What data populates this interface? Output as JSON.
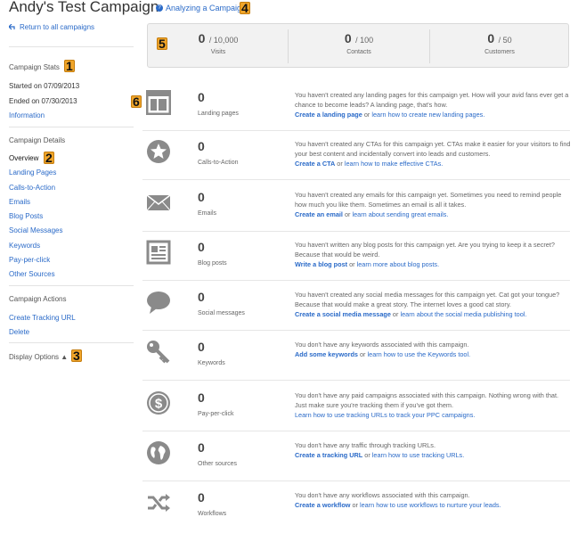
{
  "header": {
    "title": "Andy's Test Campaign",
    "help_link": "Analyzing a Campaign"
  },
  "badges": [
    "1",
    "2",
    "3",
    "4",
    "5",
    "6"
  ],
  "sidebar": {
    "back_link": "Return to all campaigns",
    "stats_heading": "Campaign Stats",
    "started": "Started on 07/09/2013",
    "ended": "Ended on 07/30/2013",
    "information": "Information",
    "details_heading": "Campaign Details",
    "details_items": [
      "Overview",
      "Landing Pages",
      "Calls-to-Action",
      "Emails",
      "Blog Posts",
      "Social Messages",
      "Keywords",
      "Pay-per-click",
      "Other Sources"
    ],
    "actions_heading": "Campaign Actions",
    "actions_items": [
      "Create Tracking URL",
      "Delete"
    ],
    "display_options": "Display Options ▲"
  },
  "stats": [
    {
      "value": "0",
      "limit": "/ 10,000",
      "label": "Visits"
    },
    {
      "value": "0",
      "limit": "/ 100",
      "label": "Contacts"
    },
    {
      "value": "0",
      "limit": "/ 50",
      "label": "Customers"
    }
  ],
  "rows": [
    {
      "count": "0",
      "label": "Landing pages",
      "icon": "landing-page-icon",
      "text": "You haven't created any landing pages for this campaign yet. How will your avid fans ever get a chance to become leads? A landing page, that's how.",
      "cta": "Create a landing page",
      "or": " or ",
      "alt": "learn how to create new landing pages."
    },
    {
      "count": "0",
      "label": "Calls-to-Action",
      "icon": "star-icon",
      "text": "You haven't created any CTAs for this campaign yet. CTAs make it easier for your visitors to find your best content and incidentally convert into leads and customers.",
      "cta": "Create a CTA",
      "or": " or ",
      "alt": "learn how to make effective CTAs."
    },
    {
      "count": "0",
      "label": "Emails",
      "icon": "envelope-icon",
      "text": "You haven't created any emails for this campaign yet. Sometimes you need to remind people how much you like them. Sometimes an email is all it takes.",
      "cta": "Create an email",
      "or": " or ",
      "alt": "learn about sending great emails."
    },
    {
      "count": "0",
      "label": "Blog posts",
      "icon": "newspaper-icon",
      "text": "You haven't written any blog posts for this campaign yet. Are you trying to keep it a secret? Because that would be weird.",
      "cta": "Write a blog post",
      "or": " or ",
      "alt": "learn more about blog posts."
    },
    {
      "count": "0",
      "label": "Social messages",
      "icon": "speech-bubble-icon",
      "text": "You haven't created any social media messages for this campaign yet. Cat got your tongue? Because that would make a great story. The internet loves a good cat story.",
      "cta": "Create a social media message",
      "or": " or ",
      "alt": "learn about the social media publishing tool."
    },
    {
      "count": "0",
      "label": "Keywords",
      "icon": "key-icon",
      "text": "You don't have any keywords associated with this campaign.",
      "cta": "Add some keywords",
      "or": " or ",
      "alt": "learn how to use the Keywords tool."
    },
    {
      "count": "0",
      "label": "Pay-per-click",
      "icon": "dollar-icon",
      "text": "You don't have any paid campaigns associated with this campaign. Nothing wrong with that. Just make sure you're tracking them if you've got them.",
      "cta": "",
      "or": "",
      "alt": "Learn how to use tracking URLs to track your PPC campaigns."
    },
    {
      "count": "0",
      "label": "Other sources",
      "icon": "globe-icon",
      "text": "You don't have any traffic through tracking URLs.",
      "cta": "Create a tracking URL",
      "or": " or ",
      "alt": "learn how to use tracking URLs."
    },
    {
      "count": "0",
      "label": "Workflows",
      "icon": "shuffle-icon",
      "text": "You don't have any workflows associated with this campaign.",
      "cta": "Create a workflow",
      "or": " or ",
      "alt": "learn how to use workflows to nurture your leads."
    }
  ]
}
